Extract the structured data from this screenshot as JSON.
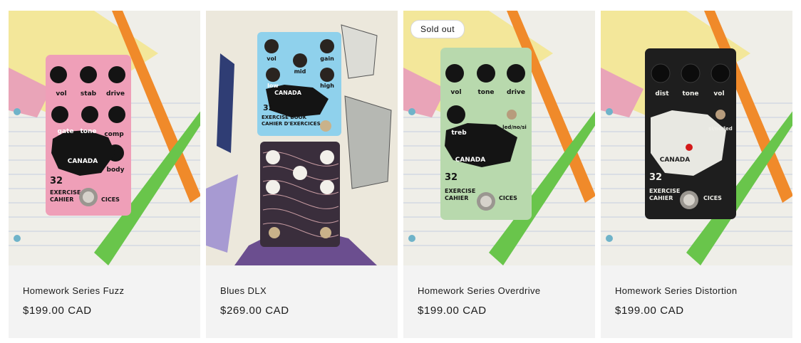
{
  "products": [
    {
      "title": "Homework Series Fuzz",
      "price": "$199.00 CAD",
      "pedal_color": "#ef9fb8",
      "knobs_top": [
        "vol",
        "stab",
        "drive"
      ],
      "knobs_mid": [
        "gate",
        "tone",
        "comp"
      ],
      "knob_bottom": "body",
      "image_icon": "fuzz-pedal-photo"
    },
    {
      "title": "Blues DLX",
      "price": "$269.00 CAD",
      "pedal_color": "#8fd1ec",
      "knobs_top": [
        "vol",
        "mid",
        "gain"
      ],
      "knobs_mid": [
        "low",
        "high"
      ],
      "image_icon": "blues-dlx-pedal-photo"
    },
    {
      "title": "Homework Series Overdrive",
      "price": "$199.00 CAD",
      "badge": "Sold out",
      "pedal_color": "#b8d9ad",
      "knobs_top": [
        "vol",
        "tone",
        "drive"
      ],
      "knobs_mid": [
        "treb",
        "led/no/si"
      ],
      "image_icon": "overdrive-pedal-photo"
    },
    {
      "title": "Homework Series Distortion",
      "price": "$199.00 CAD",
      "pedal_color": "#1e1e1e",
      "knobs_top": [
        "dist",
        "tone",
        "vol"
      ],
      "knobs_mid": [
        "si/no/led"
      ],
      "image_icon": "distortion-pedal-photo"
    }
  ],
  "pedal_print": {
    "country": "CANADA",
    "pages": "32",
    "book": "EXERCISE BOOK",
    "book_fr": "CAHIER D'EXERCICES"
  }
}
